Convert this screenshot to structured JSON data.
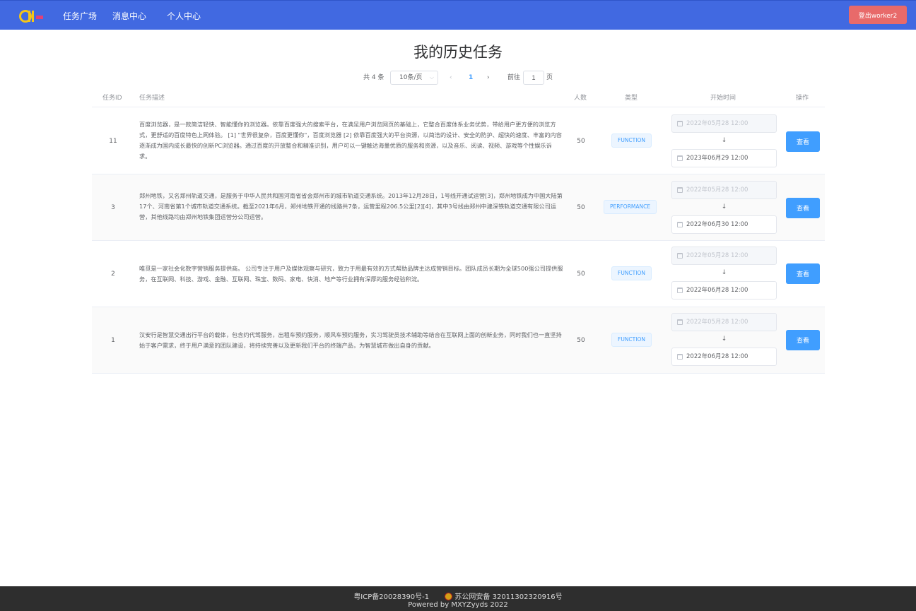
{
  "header": {
    "logo_text": "C",
    "nav": [
      {
        "label": "任务广场"
      },
      {
        "label": "消息中心"
      },
      {
        "label": "个人中心"
      }
    ],
    "logout_label": "登出worker2",
    "colors": {
      "bar": "#4169e1",
      "logout": "#e86a6a"
    }
  },
  "main": {
    "title": "我的历史任务",
    "pagination": {
      "total_label": "共 4 条",
      "page_size": "10条/页",
      "prev_icon": "chevron-left-icon",
      "current_page": "1",
      "next_icon": "chevron-right-icon",
      "goto_label": "前往",
      "goto_value": "1",
      "page_suffix": "页"
    },
    "columns": [
      "任务ID",
      "任务描述",
      "人数",
      "类型",
      "开始时间",
      "操作"
    ],
    "rows": [
      {
        "id": "11",
        "desc": "百度浏览器，是一款简洁轻快、智能懂你的浏览器。依靠百度强大的搜索平台，在满足用户浏览网页的基础上，它整合百度体系业务优势，带给用户更方便的浏览方式，更舒适的百度特色上网体验。 [1] \"世界很复杂，百度更懂你\"，百度浏览器 [2] 依靠百度强大的平台资源，以简洁的设计、安全的防护、超快的速度、丰富的内容逐渐成为国内成长最快的创新PC浏览器。通过百度的开放整合和精准识别，用户可以一键触达海量优质的服务和资源，以及音乐、阅读、视频、游戏等个性娱乐诉求。",
        "count": "50",
        "type": "FUNCTION",
        "start": "2022年05月28 12:00",
        "arrow": "↓",
        "end": "2023年06月29 12:00",
        "action": "查看"
      },
      {
        "id": "3",
        "desc": "郑州地铁，又名郑州轨道交通，是服务于中华人民共和国河南省省会郑州市的城市轨道交通系统。2013年12月28日，1号线开通试运营[3]，郑州地铁成为中国大陆第17个、河南省第1个城市轨道交通系统。截至2021年6月，郑州地铁开通的线路共7条，运营里程206.5公里[2][4]，其中3号线由郑州中建深铁轨道交通有限公司运营，其他线路均由郑州地铁集团运营分公司运营。",
        "count": "50",
        "type": "PERFORMANCE",
        "start": "2022年05月28 12:00",
        "arrow": "↓",
        "end": "2022年06月30 12:00",
        "action": "查看"
      },
      {
        "id": "2",
        "desc": "唯觅是一家社会化数字营销服务提供商。 公司专注于用户及媒体观察与研究，致力于用最有效的方式帮助品牌主达成营销目标。团队成员长期为全球500强公司提供服务，在互联网、科技、游戏、金融、互联网、珠宝、数码、家电、快消、地产等行业拥有深厚的服务经验积淀。",
        "count": "50",
        "type": "FUNCTION",
        "start": "2022年05月28 12:00",
        "arrow": "↓",
        "end": "2022年06月28 12:00",
        "action": "查看"
      },
      {
        "id": "1",
        "desc": "汉安行是智慧交通出行平台的载体，包含约代驾服务，出租车预约服务，顺风车预约服务，实习驾驶员技术辅助等结合在互联网上面的创新业务，同时我们也一直坚持始于客户需求，终于用户满意的团队建设，将持续完善以及更新我们平台的终端产品，为智慧城市做出自身的贡献。",
        "count": "50",
        "type": "FUNCTION",
        "start": "2022年05月28 12:00",
        "arrow": "↓",
        "end": "2022年06月28 12:00",
        "action": "查看"
      }
    ]
  },
  "footer": {
    "icp": "粤ICP备20028390号-1",
    "police": "苏公网安备 32011302320916号",
    "powered": "Powered by MXYZyyds 2022"
  }
}
